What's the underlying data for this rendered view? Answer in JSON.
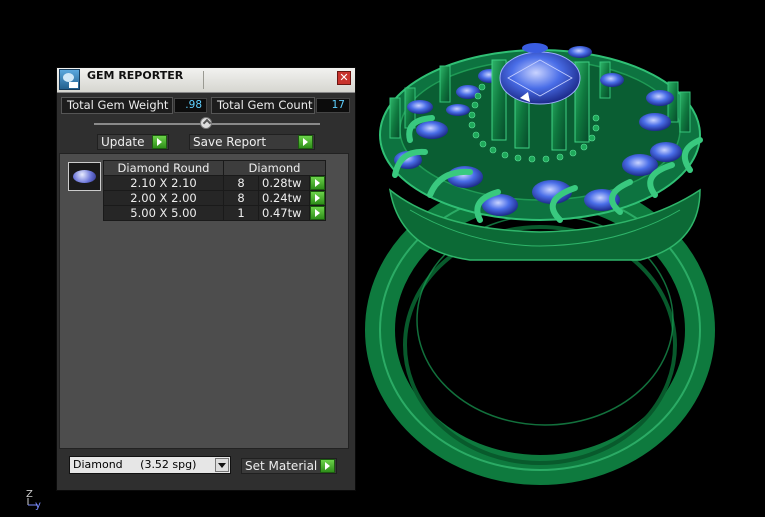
{
  "viewport": {
    "axis_z": "Z",
    "axis_y": "y",
    "colors": {
      "metal": "#0f7a3f",
      "metal_light": "#2fb56a",
      "gem": "#4a6ee8",
      "background": "#000000"
    }
  },
  "panel": {
    "title": "GEM REPORTER",
    "icon": "gem-reporter-app-icon",
    "close_glyph": "✕",
    "total_weight_label": "Total Gem Weight",
    "total_weight_value": ".98",
    "total_count_label": "Total Gem Count",
    "total_count_value": "17",
    "update_label": "Update",
    "save_report_label": "Save Report",
    "table": {
      "shape_header": "Diamond Round",
      "material_header": "Diamond",
      "rows": [
        {
          "size": "2.10 X 2.10",
          "count": "8",
          "weight": "0.28tw"
        },
        {
          "size": "2.00 X 2.00",
          "count": "8",
          "weight": "0.24tw"
        },
        {
          "size": "5.00 X 5.00",
          "count": "1",
          "weight": "0.47tw"
        }
      ]
    },
    "material_select": "Diamond     (3.52 spg)",
    "set_material_label": "Set Material",
    "accent_color": "#4cb82e",
    "value_color": "#5fd0ff"
  }
}
